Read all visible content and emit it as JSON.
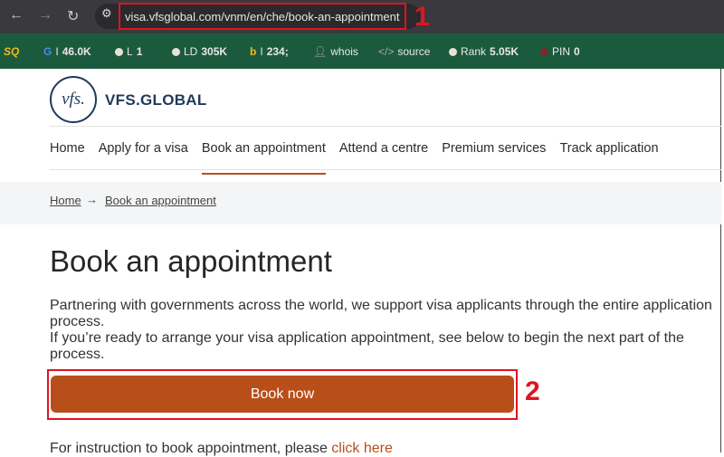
{
  "browser": {
    "url": "visa.vfsglobal.com/vnm/en/che/book-an-appointment",
    "annotation_1": "1",
    "annotation_2": "2"
  },
  "seo_toolbar": {
    "logo": "SQ",
    "items": [
      {
        "icon": "google-icon",
        "label": "I",
        "value": "46.0K"
      },
      {
        "icon": "circle-icon",
        "label": "L",
        "value": "1"
      },
      {
        "icon": "circle-icon",
        "label": "LD",
        "value": "305K"
      },
      {
        "icon": "bing-icon",
        "label": "I",
        "value": "234;"
      },
      {
        "icon": "person-icon",
        "label": "whois",
        "value": ""
      },
      {
        "icon": "code-icon",
        "label": "source",
        "value": ""
      },
      {
        "icon": "circle-icon",
        "label": "Rank",
        "value": "5.05K"
      },
      {
        "icon": "pinterest-icon",
        "label": "PIN",
        "value": "0"
      }
    ]
  },
  "site": {
    "logo_mark": "vfs.",
    "brand": "VFS.GLOBAL",
    "nav": [
      "Home",
      "Apply for a visa",
      "Book an appointment",
      "Attend a centre",
      "Premium services",
      "Track application"
    ],
    "active_nav": "Book an appointment",
    "breadcrumb": [
      "Home",
      "Book an appointment"
    ],
    "title": "Book an appointment",
    "para1": "Partnering with governments across the world, we support visa applicants through the entire application process.",
    "para2": "If you’re ready to arrange your visa application appointment, see below to begin the next part of the process.",
    "book_now": "Book now",
    "instruction_text": "For instruction to book appointment, please ",
    "instruction_link": "click here",
    "accent": "#b84f1a"
  }
}
